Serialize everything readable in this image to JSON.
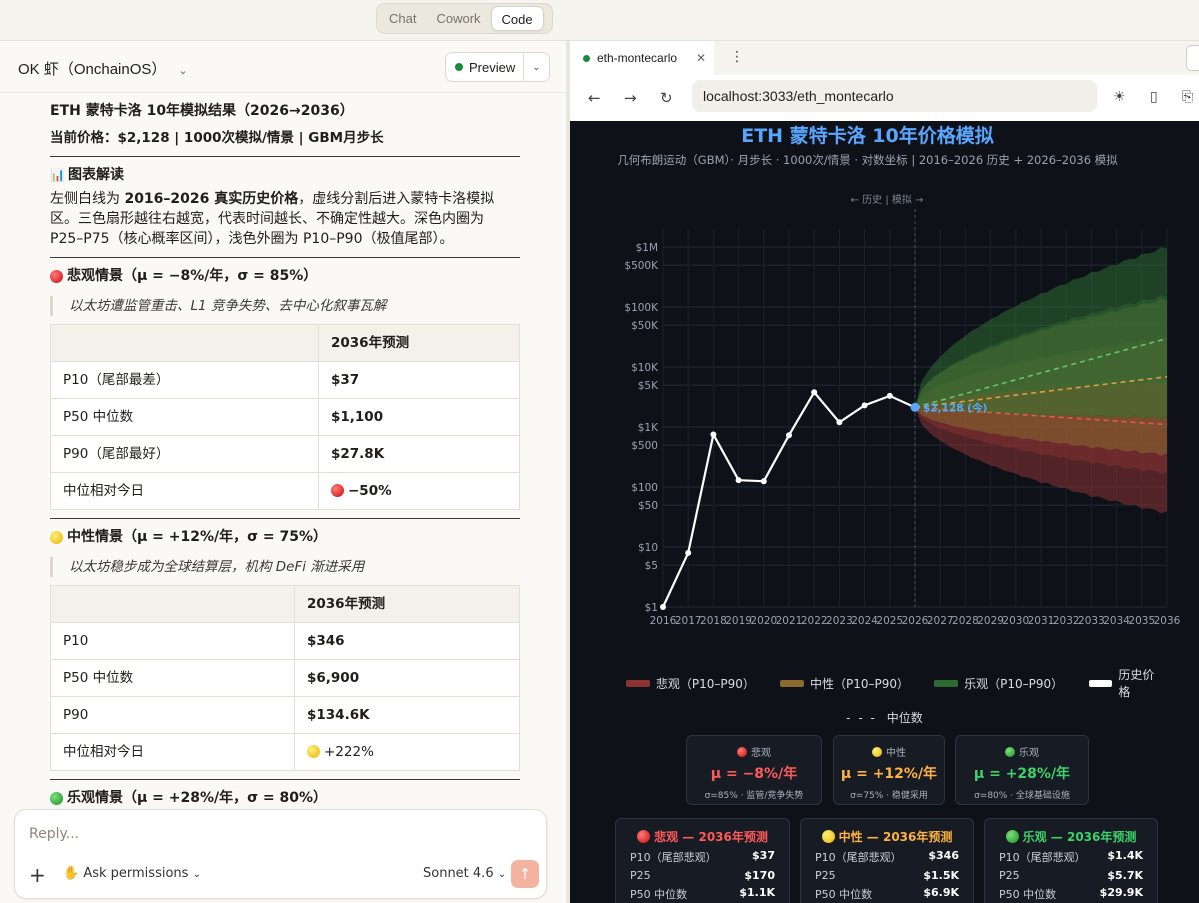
{
  "topbar": {
    "modes": [
      "Chat",
      "Cowork",
      "Code"
    ],
    "active": "Code"
  },
  "left": {
    "project": "OK 虾（OnchainOS）",
    "preview_label": "Preview",
    "title": "ETH 蒙特卡洛 10年模拟结果（2026→2036）",
    "subtitle": "当前价格：$2,128 | 1000次模拟/情景 | GBM月步长",
    "chart_reading_icon": "📊",
    "chart_reading": "图表解读",
    "para_a": "左侧白线为 ",
    "para_bold": "2016–2026 真实历史价格",
    "para_b": "，虚线分割后进入蒙特卡洛模拟区。三色扇形越往右越宽，代表时间越长、不确定性越大。深色内圈为 P25–P75（核心概率区间），浅色外圈为 P10–P90（极值尾部）。",
    "bear": {
      "heading": "悲观情景（μ = −8%/年，σ = 85%）",
      "quote": "以太坊遭监管重击、L1 竞争失势、去中心化叙事瓦解",
      "col": "2036年预测",
      "rows": [
        [
          "P10（尾部最差）",
          "$37"
        ],
        [
          "P50 中位数",
          "$1,100"
        ],
        [
          "P90（尾部最好）",
          "$27.8K"
        ],
        [
          "中位相对今日",
          "−50%"
        ]
      ]
    },
    "neutral": {
      "heading": "中性情景（μ = +12%/年，σ = 75%）",
      "quote": "以太坊稳步成为全球结算层，机构 DeFi 渐进采用",
      "col": "2036年预测",
      "rows": [
        [
          "P10",
          "$346"
        ],
        [
          "P50 中位数",
          "$6,900"
        ],
        [
          "P90",
          "$134.6K"
        ],
        [
          "中位相对今日",
          "+222%"
        ]
      ]
    },
    "bull": {
      "heading": "乐观情景（μ = +28%/年，σ = 80%）"
    },
    "reply": {
      "placeholder": "Reply...",
      "permissions": "Ask permissions",
      "model": "Sonnet 4.6"
    }
  },
  "browser": {
    "tab_title": "eth-montecarlo",
    "url": "localhost:3033/eth_montecarlo",
    "chart_title": "ETH 蒙特卡洛 10年价格模拟",
    "chart_subtitle": "几何布朗运动（GBM）· 月步长 · 1000次/情景 · 对数坐标 | 2016–2026 历史 + 2026–2036 模拟",
    "divider_label": "← 历史 | 模拟 →",
    "current_label": "$2,128 (今)",
    "legend": [
      {
        "name": "悲观（P10–P90）",
        "color": "#8b3434"
      },
      {
        "name": "中性（P10–P90）",
        "color": "#8a6a2e"
      },
      {
        "name": "乐观（P10–P90）",
        "color": "#2e6b33"
      },
      {
        "name": "历史价格",
        "color": "#ffffff"
      }
    ],
    "median_legend": "中位数",
    "cards": [
      {
        "name": "悲观",
        "mu": "μ = −8%/年",
        "desc": "σ=85% · 监管/竞争失势",
        "color": "#ff5a5a"
      },
      {
        "name": "中性",
        "mu": "μ = +12%/年",
        "desc": "σ=75% · 稳健采用",
        "color": "#ffb23f"
      },
      {
        "name": "乐观",
        "mu": "μ = +28%/年",
        "desc": "σ=80% · 全球基础设施",
        "color": "#3ed06a"
      }
    ],
    "pcards": [
      {
        "title": "悲观 — 2036年预测",
        "color": "#ff5a5a",
        "rows": [
          [
            "P10（尾部悲观）",
            "$37"
          ],
          [
            "P25",
            "$170"
          ],
          [
            "P50 中位数",
            "$1.1K"
          ]
        ]
      },
      {
        "title": "中性 — 2036年预测",
        "color": "#ffb23f",
        "rows": [
          [
            "P10（尾部悲观）",
            "$346"
          ],
          [
            "P25",
            "$1.5K"
          ],
          [
            "P50 中位数",
            "$6.9K"
          ]
        ]
      },
      {
        "title": "乐观 — 2036年预测",
        "color": "#3ed06a",
        "rows": [
          [
            "P10（尾部悲观）",
            "$1.4K"
          ],
          [
            "P25",
            "$5.7K"
          ],
          [
            "P50 中位数",
            "$29.9K"
          ]
        ]
      }
    ]
  },
  "chart_data": {
    "type": "line",
    "title": "ETH 蒙特卡洛 10年价格模拟",
    "y_scale": "log",
    "ylim": [
      1,
      2000000
    ],
    "y_ticks": [
      "$1",
      "$5",
      "$10",
      "$50",
      "$100",
      "$500",
      "$1K",
      "$5K",
      "$10K",
      "$50K",
      "$100K",
      "$500K",
      "$1M"
    ],
    "y_tick_values": [
      1,
      5,
      10,
      50,
      100,
      500,
      1000,
      5000,
      10000,
      50000,
      100000,
      500000,
      1000000
    ],
    "x_ticks": [
      "2016",
      "2017",
      "2018",
      "2019",
      "2020",
      "2021",
      "2022",
      "2023",
      "2024",
      "2025",
      "2026",
      "2027",
      "2028",
      "2029",
      "2030",
      "2031",
      "2032",
      "2033",
      "2034",
      "2035",
      "2036"
    ],
    "history": {
      "name": "历史价格",
      "x": [
        2016,
        2017,
        2018,
        2019,
        2020,
        2021,
        2022,
        2023,
        2024,
        2025,
        2026
      ],
      "y": [
        1,
        8,
        750,
        130,
        125,
        730,
        3800,
        1200,
        2300,
        3300,
        2128
      ]
    },
    "projections": [
      {
        "name": "悲观",
        "p10_2036": 37,
        "p25_2036": 170,
        "p50_2036": 1100,
        "p90_2036": 27800,
        "color": "#8b3434"
      },
      {
        "name": "中性",
        "p10_2036": 346,
        "p25_2036": 1500,
        "p50_2036": 6900,
        "p90_2036": 134600,
        "color": "#8a6a2e"
      },
      {
        "name": "乐观",
        "p10_2036": 1400,
        "p25_2036": 5700,
        "p50_2036": 29900,
        "p90_2036": 1000000,
        "color": "#2e6b33"
      }
    ],
    "grid": true,
    "legend_position": "bottom"
  }
}
